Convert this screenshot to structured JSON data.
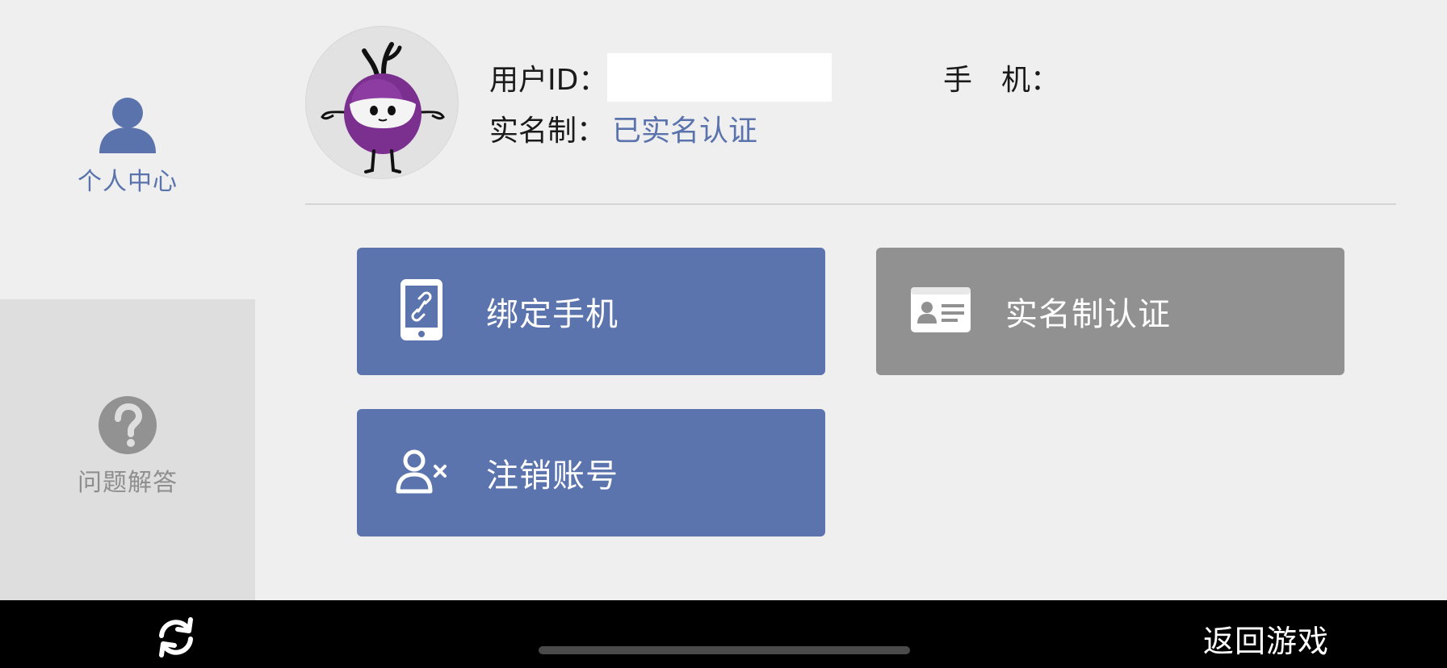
{
  "sidebar": {
    "items": [
      {
        "label": "个人中心",
        "icon": "person-icon",
        "active": true
      },
      {
        "label": "问题解答",
        "icon": "question-icon",
        "active": false
      }
    ]
  },
  "profile": {
    "avatar": "mascot-avatar",
    "user_id_label": "用户ID：",
    "user_id_value": "",
    "phone_label": "手　机：",
    "phone_value": "",
    "realname_label": "实名制：",
    "realname_status": "已实名认证"
  },
  "actions": {
    "bind_phone": {
      "label": "绑定手机",
      "icon": "phone-link-icon"
    },
    "realname_auth": {
      "label": "实名制认证",
      "icon": "id-card-icon"
    },
    "cancel_account": {
      "label": "注销账号",
      "icon": "remove-user-icon"
    }
  },
  "bottombar": {
    "refresh_icon": "refresh-icon",
    "back_label": "返回游戏"
  },
  "colors": {
    "accent": "#5c74ad",
    "disabled": "#919191",
    "sidebar_inactive": "#dedede",
    "background": "#efefef"
  }
}
